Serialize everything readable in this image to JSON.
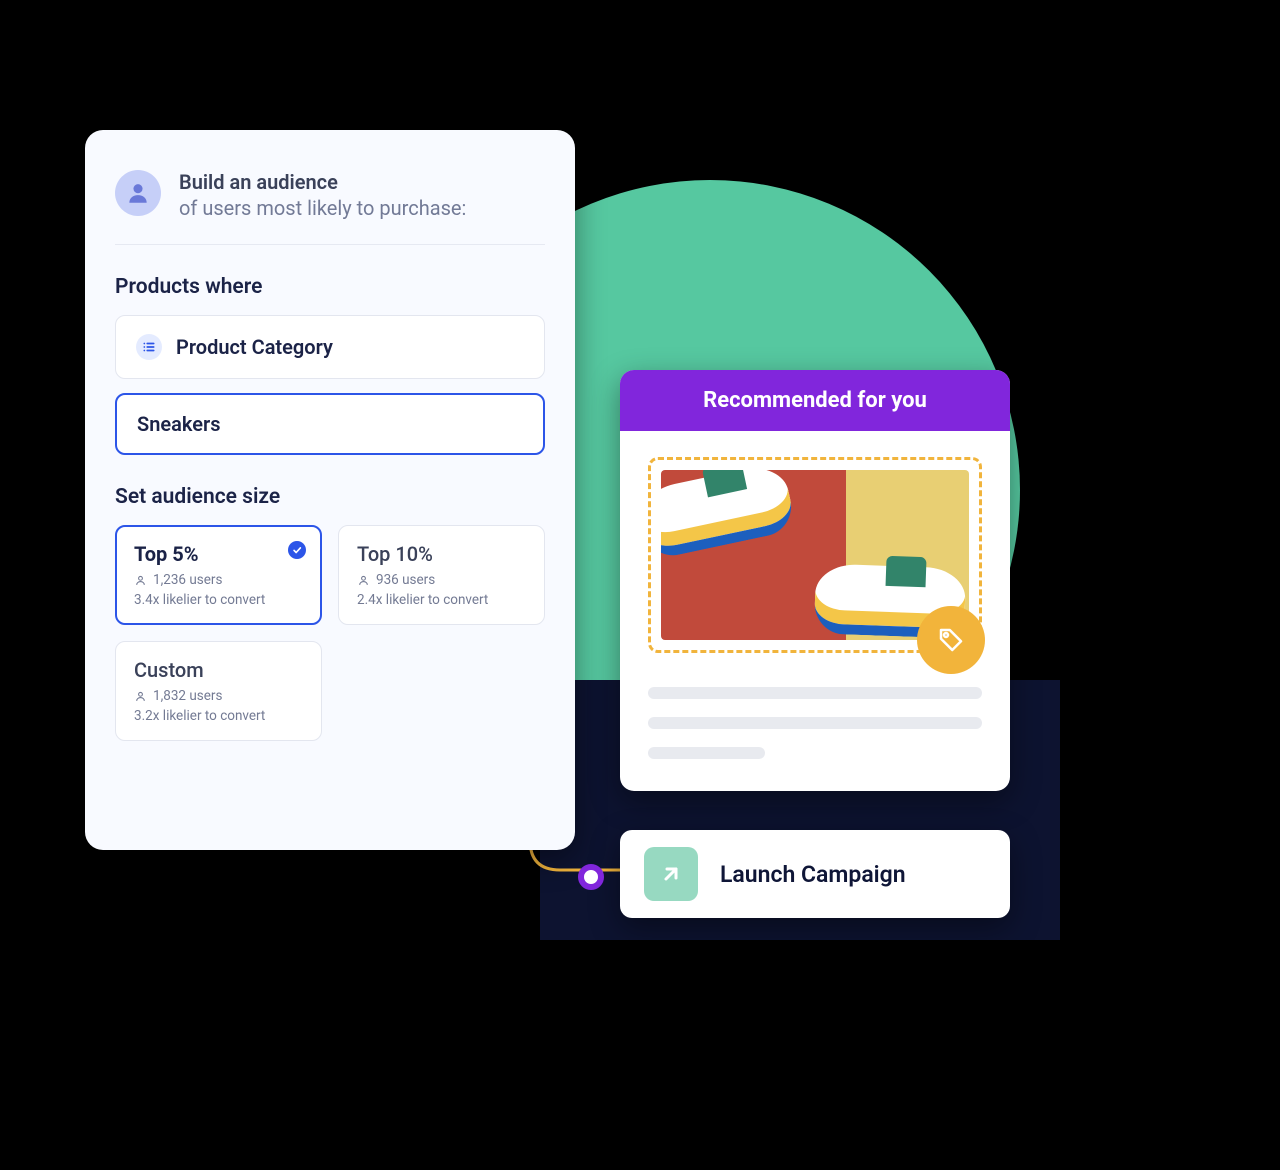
{
  "builder": {
    "title": "Build an audience",
    "subtitle": "of users most likely to purchase:",
    "products_label": "Products where",
    "category_field_label": "Product Category",
    "category_value": "Sneakers",
    "size_label": "Set audience size",
    "options": [
      {
        "title": "Top 5%",
        "users": "1,236 users",
        "conv": "3.4x likelier to convert",
        "selected": true
      },
      {
        "title": "Top 10%",
        "users": "936 users",
        "conv": "2.4x likelier to convert",
        "selected": false
      },
      {
        "title": "Custom",
        "users": "1,832 users",
        "conv": "3.2x likelier to convert",
        "selected": false
      }
    ]
  },
  "reco": {
    "header": "Recommended for you"
  },
  "launch": {
    "label": "Launch Campaign"
  },
  "colors": {
    "accent_purple": "#8126dc",
    "accent_blue": "#2c55e8",
    "accent_green": "#56c8a0",
    "accent_amber": "#f1b43c"
  }
}
